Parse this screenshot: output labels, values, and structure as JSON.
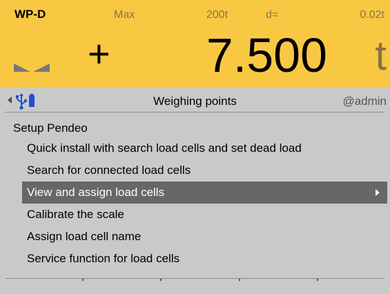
{
  "display": {
    "scale_name": "WP-D",
    "max_label": "Max",
    "max_value": "200t",
    "d_label": "d=",
    "d_value": "0.02t",
    "sign": "+",
    "weight": "7.500",
    "unit": "t",
    "colors": {
      "background": "#f9c843",
      "muted_text": "#8a7340"
    },
    "zero_indicator_icon": "zero-center-icon"
  },
  "titlebar": {
    "back_icon": "back-arrow-icon",
    "usb_icon": "usb-icon",
    "title": "Weighing points",
    "user": "@admin"
  },
  "section": {
    "title": "Setup Pendeo"
  },
  "menu": {
    "items": [
      {
        "label": "Quick install with search load cells and set dead load",
        "selected": false
      },
      {
        "label": "Search for connected load cells",
        "selected": false
      },
      {
        "label": "View and assign load cells",
        "selected": true,
        "icon": "submenu-arrow-icon"
      },
      {
        "label": "Calibrate the scale",
        "selected": false
      },
      {
        "label": "Assign load cell name",
        "selected": false
      },
      {
        "label": "Service function for load cells",
        "selected": false
      }
    ],
    "colors": {
      "selected_bg": "#676767",
      "selected_text": "#ffffff"
    }
  },
  "softkeys": {
    "count": 5,
    "labels": [
      "",
      "",
      "",
      "",
      ""
    ]
  }
}
